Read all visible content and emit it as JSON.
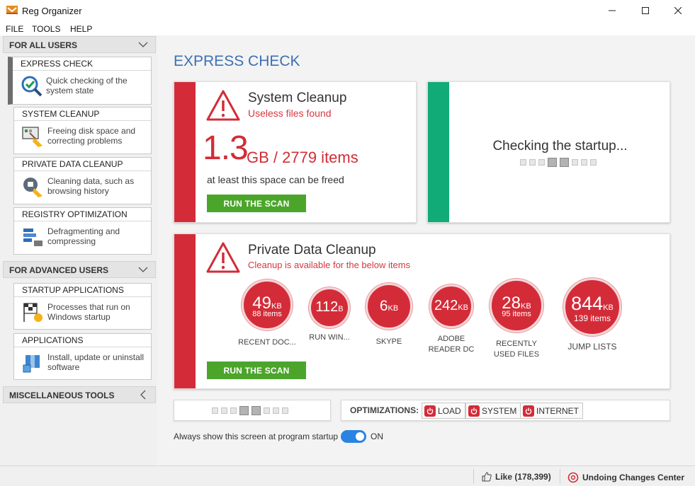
{
  "window": {
    "title": "Reg Organizer"
  },
  "menu": [
    "FILE",
    "TOOLS",
    "HELP"
  ],
  "sidebar": {
    "sections": [
      {
        "label": "FOR ALL USERS",
        "items": [
          {
            "title": "EXPRESS CHECK",
            "desc": "Quick checking of the system state",
            "icon": "magnifier-check-icon",
            "active": true
          },
          {
            "title": "SYSTEM CLEANUP",
            "desc": "Freeing disk space and correcting problems",
            "icon": "broom-screen-icon"
          },
          {
            "title": "PRIVATE DATA CLEANUP",
            "desc": "Cleaning data, such as browsing history",
            "icon": "broom-globe-icon"
          },
          {
            "title": "REGISTRY OPTIMIZATION",
            "desc": "Defragmenting and compressing",
            "icon": "registry-blocks-icon"
          }
        ]
      },
      {
        "label": "FOR ADVANCED USERS",
        "items": [
          {
            "title": "STARTUP APPLICATIONS",
            "desc": "Processes that run on Windows startup",
            "icon": "startup-flag-icon"
          },
          {
            "title": "APPLICATIONS",
            "desc": "Install, update or uninstall software",
            "icon": "package-icon"
          }
        ]
      },
      {
        "label": "MISCELLANEOUS TOOLS"
      }
    ]
  },
  "main": {
    "title": "EXPRESS CHECK",
    "system_cleanup": {
      "title": "System Cleanup",
      "subtitle": "Useless files found",
      "big_value": "1.3",
      "big_unit": "GB / 2779 items",
      "note": "at least this space can be freed",
      "button": "RUN THE SCAN",
      "accent": "#d32c38"
    },
    "startup_check": {
      "text": "Checking the startup...",
      "accent": "#10ab77"
    },
    "private_data": {
      "title": "Private Data Cleanup",
      "subtitle": "Cleanup is available for the below items",
      "button": "RUN THE SCAN",
      "items": [
        {
          "value": "49",
          "unit": "KB",
          "items": "88 items",
          "label": "RECENT DOC..."
        },
        {
          "value": "112",
          "unit": "B",
          "items": "",
          "label": "RUN WIN..."
        },
        {
          "value": "6",
          "unit": "KB",
          "items": "",
          "label": "SKYPE"
        },
        {
          "value": "242",
          "unit": "KB",
          "items": "",
          "label": "ADOBE READER DC"
        },
        {
          "value": "28",
          "unit": "KB",
          "items": "95 items",
          "label": "RECENTLY USED FILES"
        },
        {
          "value": "844",
          "unit": "KB",
          "items": "139 items",
          "label": "JUMP LISTS"
        }
      ]
    },
    "optimizations": {
      "label": "OPTIMIZATIONS:",
      "buttons": [
        "LOAD",
        "SYSTEM",
        "INTERNET"
      ]
    },
    "startup_option": {
      "label": "Always show this screen at program startup",
      "state": "ON"
    }
  },
  "status": {
    "like": "Like (178,399)",
    "undo": "Undoing Changes Center"
  }
}
